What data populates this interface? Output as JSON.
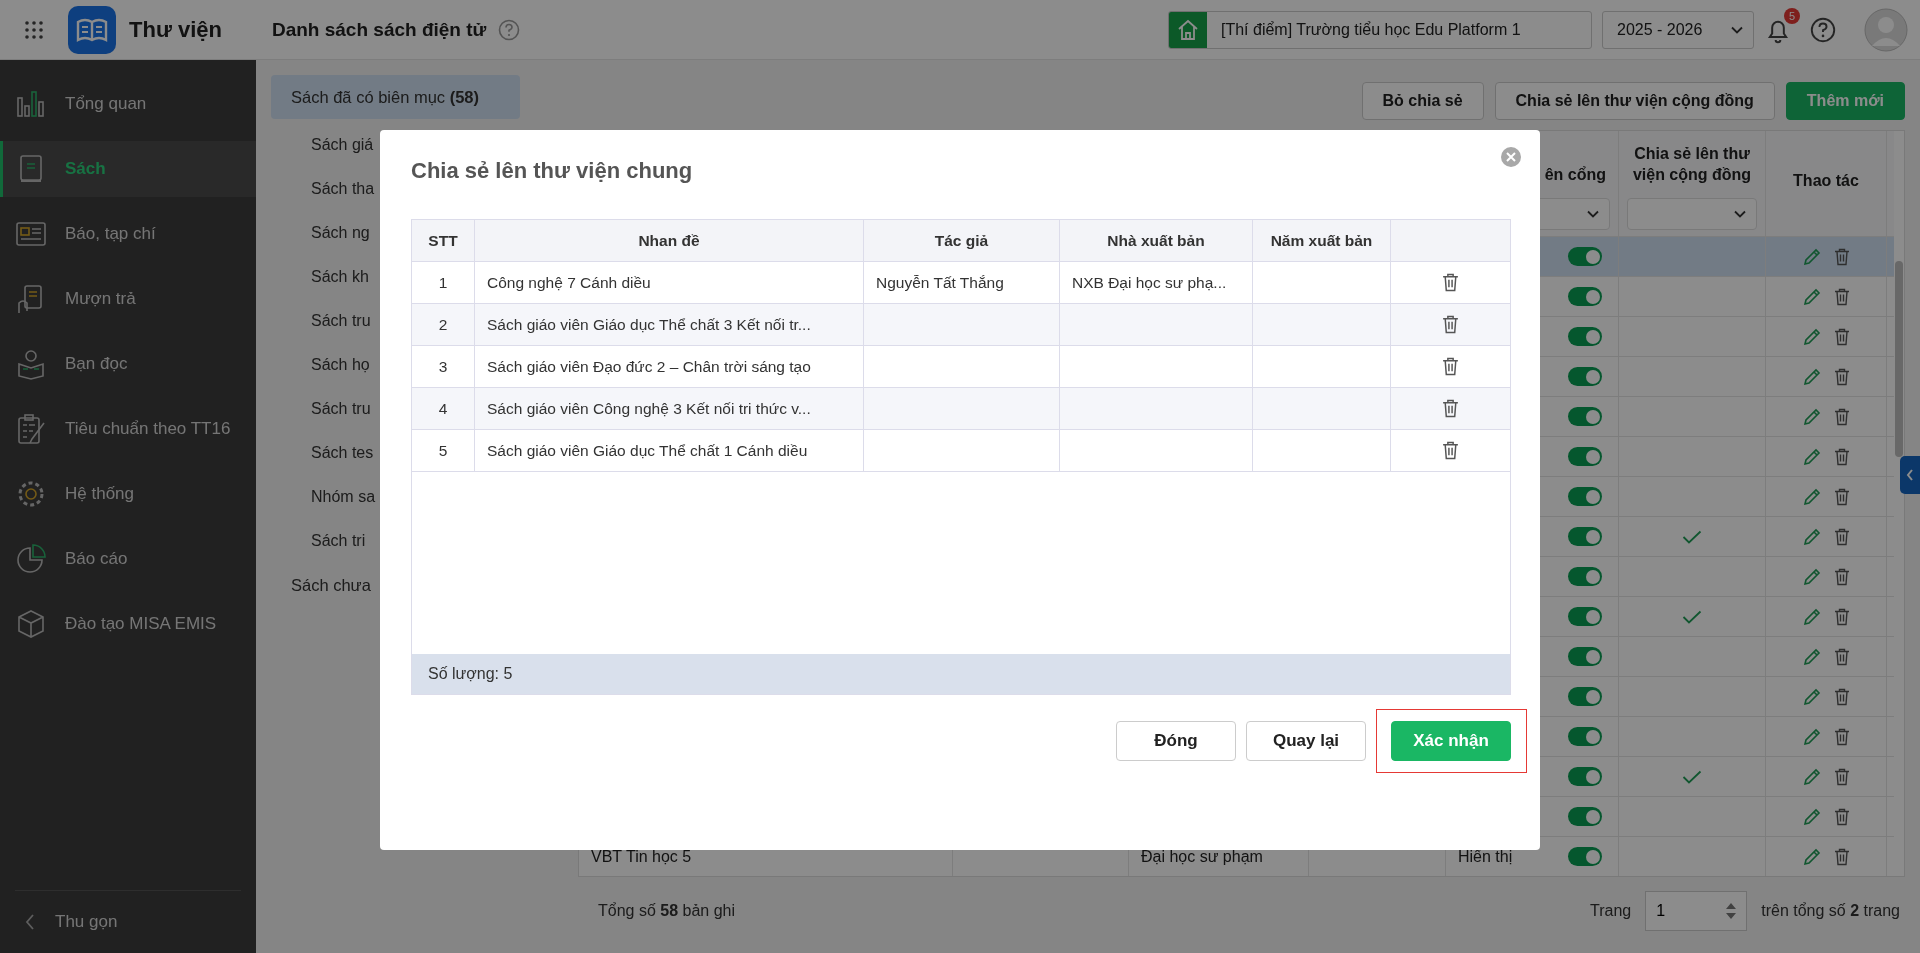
{
  "header": {
    "app_title": "Thư viện",
    "page_title": "Danh sách sách điện tử",
    "school": "[Thí điểm] Trường tiểu học Edu Platform 1",
    "year": "2025 - 2026",
    "notification_count": "5"
  },
  "sidebar": {
    "items": [
      {
        "label": "Tổng quan",
        "kind": "chart",
        "selected": false
      },
      {
        "label": "Sách",
        "kind": "book",
        "selected": true
      },
      {
        "label": "Báo, tạp chí",
        "kind": "newspaper",
        "selected": false
      },
      {
        "label": "Mượn trả",
        "kind": "loan",
        "selected": false
      },
      {
        "label": "Bạn đọc",
        "kind": "reader",
        "selected": false
      },
      {
        "label": "Tiêu chuẩn theo TT16",
        "kind": "checklist",
        "selected": false
      },
      {
        "label": "Hệ thống",
        "kind": "gear",
        "selected": false
      },
      {
        "label": "Báo cáo",
        "kind": "pie",
        "selected": false
      },
      {
        "label": "Đào tạo MISA EMIS",
        "kind": "cube",
        "selected": false
      }
    ],
    "collapse_label": "Thu gọn"
  },
  "categories": [
    {
      "label": "Sách đã có biên mục **(58)**",
      "selected": true,
      "children": [
        {
          "label": "Sách giá",
          "selected": false
        },
        {
          "label": "Sách tha",
          "selected": false
        },
        {
          "label": "Sách ng",
          "selected": false
        },
        {
          "label": "Sách kh",
          "selected": false
        },
        {
          "label": "Sách tru",
          "selected": false
        },
        {
          "label": "Sách họ",
          "selected": false
        },
        {
          "label": "Sách tru",
          "selected": false
        },
        {
          "label": "Sách tes",
          "selected": false
        },
        {
          "label": "Nhóm sa",
          "selected": false
        },
        {
          "label": "Sách tri",
          "selected": false
        }
      ]
    },
    {
      "label": "Sách chưa",
      "selected": false
    }
  ],
  "toolbar": [
    {
      "label": "Bỏ chia sẻ",
      "kind": "outline"
    },
    {
      "label": "Chia sẻ lên thư viện cộng đồng",
      "kind": "outline"
    },
    {
      "label": "Thêm mới",
      "kind": "primary"
    }
  ],
  "books_table": {
    "columns": {
      "column_5": "ên cổng",
      "shared": "Chia sẻ lên thư viện cộng đồng",
      "actions": "Thao tác"
    },
    "rows": [
      {
        "selected": true,
        "on": true,
        "shared": false
      },
      {
        "selected": false,
        "on": true,
        "shared": false
      },
      {
        "selected": false,
        "on": true,
        "shared": false
      },
      {
        "selected": false,
        "on": true,
        "shared": false
      },
      {
        "selected": false,
        "on": true,
        "shared": false
      },
      {
        "selected": false,
        "on": true,
        "shared": false
      },
      {
        "selected": false,
        "on": true,
        "shared": false
      },
      {
        "selected": false,
        "on": true,
        "shared": true
      },
      {
        "selected": false,
        "on": true,
        "shared": false
      },
      {
        "selected": false,
        "on": true,
        "shared": true
      },
      {
        "selected": false,
        "on": true,
        "shared": false
      },
      {
        "selected": false,
        "on": true,
        "shared": false
      },
      {
        "selected": false,
        "on": true,
        "shared": false
      },
      {
        "selected": false,
        "on": true,
        "shared": true
      },
      {
        "selected": false,
        "on": true,
        "shared": false
      },
      {
        "selected": false,
        "on": true,
        "shared": false,
        "title": "VBT Tin học 5",
        "publisher": "Đại học sư phạm",
        "status": "Hiển thị"
      }
    ],
    "total": "Tổng số **58** bản ghi",
    "page_label": "Trang",
    "page": "1",
    "pages": "trên tổng số **2** trang"
  },
  "dialog": {
    "title": "Chia sẻ lên thư viện chung",
    "columns": [
      "STT",
      "Nhan đề",
      "Tác giả",
      "Nhà xuất bản",
      "Năm xuất bản"
    ],
    "rows": [
      {
        "no": "1",
        "title": "Công nghệ 7 Cánh diều",
        "author": "Nguyễn Tất Thắng",
        "publisher": "NXB Đại học sư phạ..."
      },
      {
        "no": "2",
        "title": "Sách giáo viên Giáo dục Thể chất 3 Kết nối tr..."
      },
      {
        "no": "3",
        "title": "Sách giáo viên Đạo đức 2 – Chân trời sáng tạo"
      },
      {
        "no": "4",
        "title": "Sách giáo viên Công nghệ 3 Kết nối tri thức v..."
      },
      {
        "no": "5",
        "title": "Sách giáo viên Giáo dục Thể chất 1 Cánh diều"
      }
    ],
    "count": "Số lượng: 5",
    "buttons": [
      {
        "label": "Đóng",
        "kind": "outline"
      },
      {
        "label": "Quay lại",
        "kind": "outline"
      },
      {
        "label": "Xác nhận",
        "kind": "primary"
      }
    ]
  }
}
